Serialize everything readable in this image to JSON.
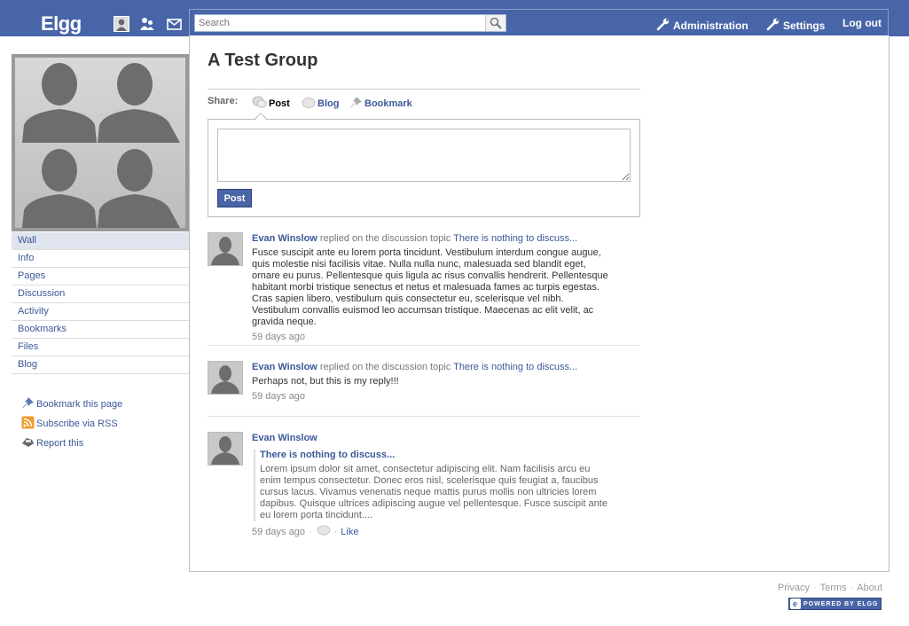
{
  "topbar": {
    "site_name": "Elgg",
    "search_placeholder": "Search",
    "admin_label": "Administration",
    "settings_label": "Settings",
    "logout_label": "Log out",
    "icons": [
      "profile-icon",
      "friends-icon",
      "messages-icon"
    ]
  },
  "sidebar": {
    "menu": [
      {
        "label": "Wall",
        "selected": true
      },
      {
        "label": "Info"
      },
      {
        "label": "Pages"
      },
      {
        "label": "Discussion"
      },
      {
        "label": "Activity"
      },
      {
        "label": "Bookmarks"
      },
      {
        "label": "Files"
      },
      {
        "label": "Blog"
      }
    ],
    "extras": [
      {
        "label": "Bookmark this page",
        "icon": "pin-icon"
      },
      {
        "label": "Subscribe via RSS",
        "icon": "rss-icon"
      },
      {
        "label": "Report this",
        "icon": "report-icon"
      }
    ]
  },
  "main": {
    "title": "A Test Group",
    "share_label": "Share:",
    "share_tabs": [
      {
        "label": "Post",
        "icon": "speech-bubble-icon",
        "active": true
      },
      {
        "label": "Blog",
        "icon": "bubble-icon"
      },
      {
        "label": "Bookmark",
        "icon": "pin-icon"
      }
    ],
    "post_button": "Post",
    "river": [
      {
        "author": "Evan Winslow",
        "action": "replied on the discussion topic",
        "topic": "There is nothing to discuss...",
        "message": "Fusce suscipit ante eu lorem porta tincidunt. Vestibulum interdum congue augue, quis molestie nisi facilisis vitae. Nulla nulla nunc, malesuada sed blandit eget, ornare eu purus. Pellentesque quis ligula ac risus convallis hendrerit. Pellentesque habitant morbi tristique senectus et netus et malesuada fames ac turpis egestas. Cras sapien libero, vestibulum quis consectetur eu, scelerisque vel nibh. Vestibulum convallis euismod leo accumsan tristique. Maecenas ac elit velit, ac gravida neque.",
        "time": "59 days ago"
      },
      {
        "author": "Evan Winslow",
        "action": "replied on the discussion topic",
        "topic": "There is nothing to discuss...",
        "message": "Perhaps not, but this is my reply!!!",
        "time": "59 days ago"
      },
      {
        "author": "Evan Winslow",
        "quote_title": "There is nothing to discuss...",
        "quote_text": "Lorem ipsum dolor sit amet, consectetur adipiscing elit. Nam facilisis arcu eu enim tempus consectetur. Donec eros nisl, scelerisque quis feugiat a, faucibus cursus lacus. Vivamus venenatis neque mattis purus mollis non ultricies lorem dapibus. Quisque ultrices adipiscing augue vel pellentesque. Fusce suscipit ante eu lorem porta tincidunt....",
        "time": "59 days ago",
        "like_label": "Like"
      }
    ]
  },
  "footer": {
    "links": [
      "Privacy",
      "Terms",
      "About"
    ],
    "powered": "POWERED BY ELGG"
  },
  "colors": {
    "topbar": "#4865a8",
    "link": "#3b5998"
  }
}
